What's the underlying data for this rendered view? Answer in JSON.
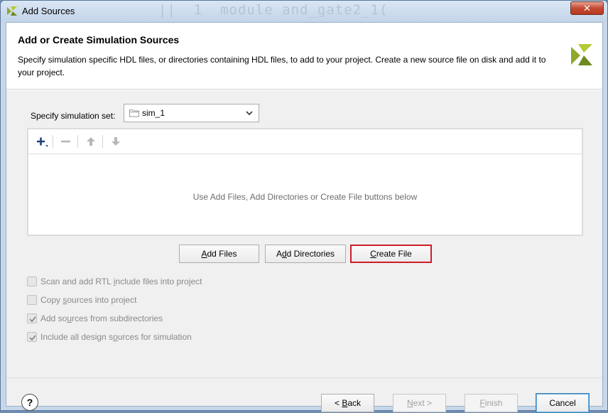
{
  "window": {
    "title": "Add Sources",
    "background_text": "||  1  module and_gate2_1(",
    "close_symbol": "✕"
  },
  "header": {
    "title": "Add or Create Simulation Sources",
    "description": "Specify simulation specific HDL files, or directories containing HDL files, to add to your project. Create a new source file on disk and add it to your project."
  },
  "simulation_set": {
    "label": "Specify simulation set:",
    "value": "sim_1"
  },
  "file_list": {
    "toolbar": [
      "add-icon",
      "remove-icon",
      "move-up-icon",
      "move-down-icon"
    ],
    "empty_message": "Use Add Files, Add Directories or Create File buttons below"
  },
  "actions": {
    "add_files": {
      "pre": "",
      "mnemonic": "A",
      "post": "dd Files"
    },
    "add_directories": {
      "pre": "A",
      "mnemonic": "d",
      "post": "d Directories"
    },
    "create_file": {
      "pre": "",
      "mnemonic": "C",
      "post": "reate File"
    }
  },
  "options": [
    {
      "pre": "Scan and add RTL ",
      "mnemonic": "i",
      "post": "nclude files into project",
      "checked": false
    },
    {
      "pre": "Copy ",
      "mnemonic": "s",
      "post": "ources into project",
      "checked": false
    },
    {
      "pre": "Add so",
      "mnemonic": "u",
      "post": "rces from subdirectories",
      "checked": true
    },
    {
      "pre": "Include all design s",
      "mnemonic": "o",
      "post": "urces for simulation",
      "checked": true
    }
  ],
  "footer": {
    "help": "?",
    "back": {
      "pre": "< ",
      "mnemonic": "B",
      "post": "ack"
    },
    "next": {
      "pre": "",
      "mnemonic": "N",
      "post": "ext >"
    },
    "finish": {
      "pre": "",
      "mnemonic": "F",
      "post": "inish"
    },
    "cancel": "Cancel"
  },
  "colors": {
    "accent_highlight": "#cc1e2b",
    "logo": "#9bb31d"
  }
}
